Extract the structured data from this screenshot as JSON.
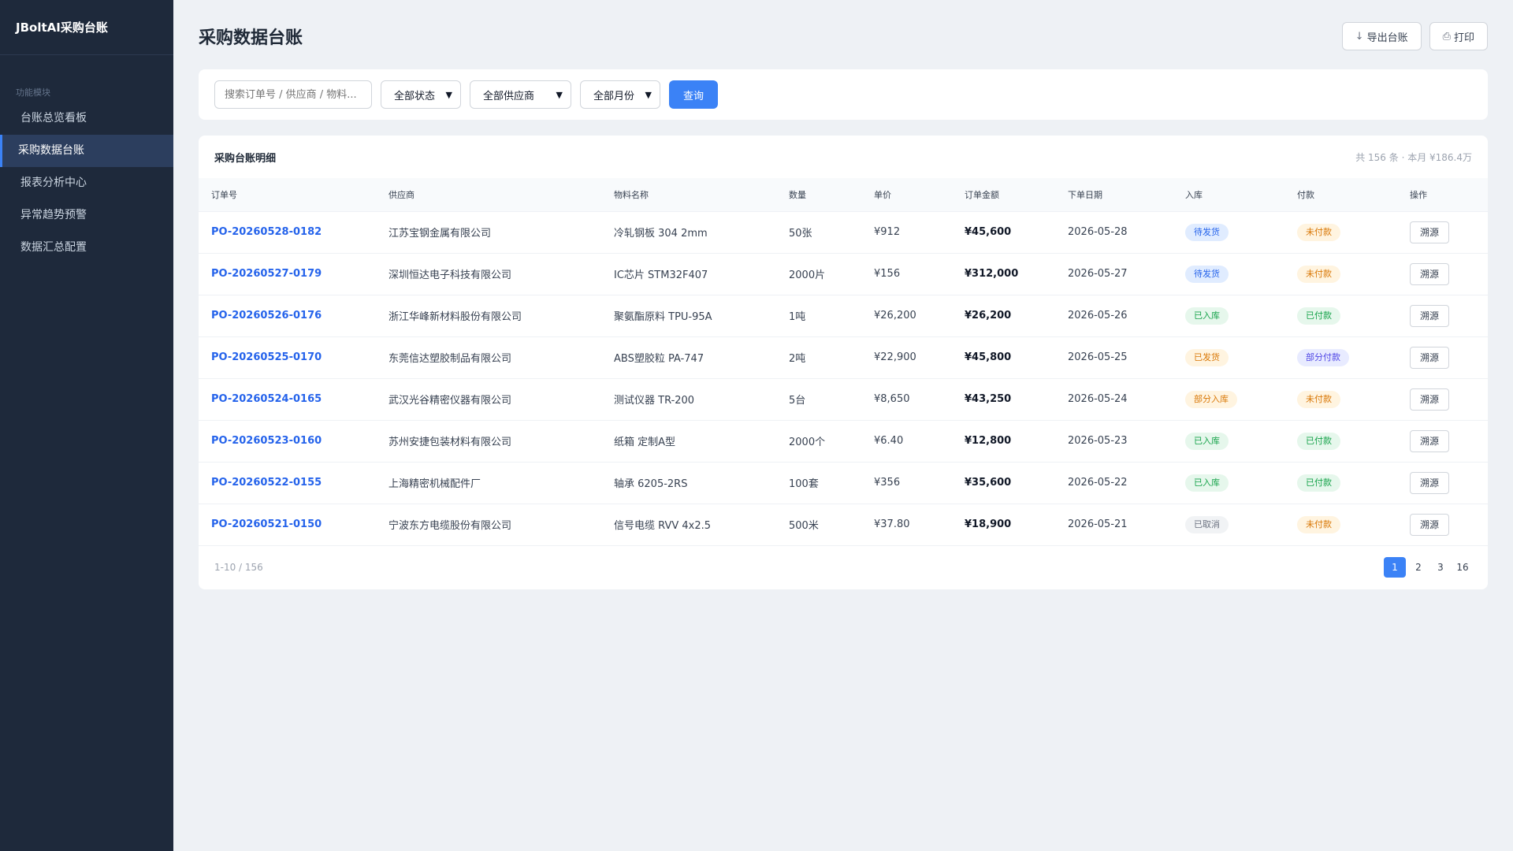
{
  "sidebar": {
    "brand": "JBoltAI采购台账",
    "section_label": "功能模块",
    "items": [
      {
        "label": "台账总览看板",
        "active": false
      },
      {
        "label": "采购数据台账",
        "active": true
      },
      {
        "label": "报表分析中心",
        "active": false
      },
      {
        "label": "异常趋势预警",
        "active": false
      },
      {
        "label": "数据汇总配置",
        "active": false
      }
    ]
  },
  "header": {
    "title": "采购数据台账",
    "export_label": "导出台账",
    "export_icon": "↓",
    "print_label": "打印",
    "print_icon": "⎙"
  },
  "filters": {
    "search_placeholder": "搜索订单号 / 供应商 / 物料...",
    "status": "全部状态",
    "supplier": "全部供应商",
    "month": "全部月份",
    "query_label": "查询"
  },
  "table": {
    "title": "采购台账明细",
    "summary": "共 156 条 · 本月 ¥186.4万",
    "columns": [
      "订单号",
      "供应商",
      "物料名称",
      "数量",
      "单价",
      "订单金额",
      "下单日期",
      "入库",
      "付款",
      "操作"
    ],
    "rows": [
      {
        "order": "PO-20260528-0182",
        "supplier": "江苏宝钢金属有限公司",
        "material": "冷轧钢板 304 2mm",
        "qty": "50张",
        "price": "¥912",
        "amount": "¥45,600",
        "date": "2026-05-28",
        "stock": "待发货",
        "stock_tone": "blue",
        "pay": "未付款",
        "pay_tone": "orange",
        "action": "溯源"
      },
      {
        "order": "PO-20260527-0179",
        "supplier": "深圳恒达电子科技有限公司",
        "material": "IC芯片 STM32F407",
        "qty": "2000片",
        "price": "¥156",
        "amount": "¥312,000",
        "date": "2026-05-27",
        "stock": "待发货",
        "stock_tone": "blue",
        "pay": "未付款",
        "pay_tone": "orange",
        "action": "溯源"
      },
      {
        "order": "PO-20260526-0176",
        "supplier": "浙江华峰新材料股份有限公司",
        "material": "聚氨酯原料 TPU-95A",
        "qty": "1吨",
        "price": "¥26,200",
        "amount": "¥26,200",
        "date": "2026-05-26",
        "stock": "已入库",
        "stock_tone": "green",
        "pay": "已付款",
        "pay_tone": "green",
        "action": "溯源"
      },
      {
        "order": "PO-20260525-0170",
        "supplier": "东莞信达塑胶制品有限公司",
        "material": "ABS塑胶粒 PA-747",
        "qty": "2吨",
        "price": "¥22,900",
        "amount": "¥45,800",
        "date": "2026-05-25",
        "stock": "已发货",
        "stock_tone": "orange",
        "pay": "部分付款",
        "pay_tone": "indigo",
        "action": "溯源"
      },
      {
        "order": "PO-20260524-0165",
        "supplier": "武汉光谷精密仪器有限公司",
        "material": "测试仪器 TR-200",
        "qty": "5台",
        "price": "¥8,650",
        "amount": "¥43,250",
        "date": "2026-05-24",
        "stock": "部分入库",
        "stock_tone": "orange",
        "pay": "未付款",
        "pay_tone": "orange",
        "action": "溯源"
      },
      {
        "order": "PO-20260523-0160",
        "supplier": "苏州安捷包装材料有限公司",
        "material": "纸箱 定制A型",
        "qty": "2000个",
        "price": "¥6.40",
        "amount": "¥12,800",
        "date": "2026-05-23",
        "stock": "已入库",
        "stock_tone": "green",
        "pay": "已付款",
        "pay_tone": "green",
        "action": "溯源"
      },
      {
        "order": "PO-20260522-0155",
        "supplier": "上海精密机械配件厂",
        "material": "轴承 6205-2RS",
        "qty": "100套",
        "price": "¥356",
        "amount": "¥35,600",
        "date": "2026-05-22",
        "stock": "已入库",
        "stock_tone": "green",
        "pay": "已付款",
        "pay_tone": "green",
        "action": "溯源"
      },
      {
        "order": "PO-20260521-0150",
        "supplier": "宁波东方电缆股份有限公司",
        "material": "信号电缆 RVV 4x2.5",
        "qty": "500米",
        "price": "¥37.80",
        "amount": "¥18,900",
        "date": "2026-05-21",
        "stock": "已取消",
        "stock_tone": "gray",
        "pay": "未付款",
        "pay_tone": "orange",
        "action": "溯源"
      }
    ]
  },
  "pagination": {
    "range": "1-10 / 156",
    "pages": [
      "1",
      "2",
      "3",
      "16"
    ],
    "current": "1"
  },
  "colors": {
    "accent": "#3b82f6",
    "sidebar_bg": "#1e293b",
    "link": "#2563eb"
  }
}
